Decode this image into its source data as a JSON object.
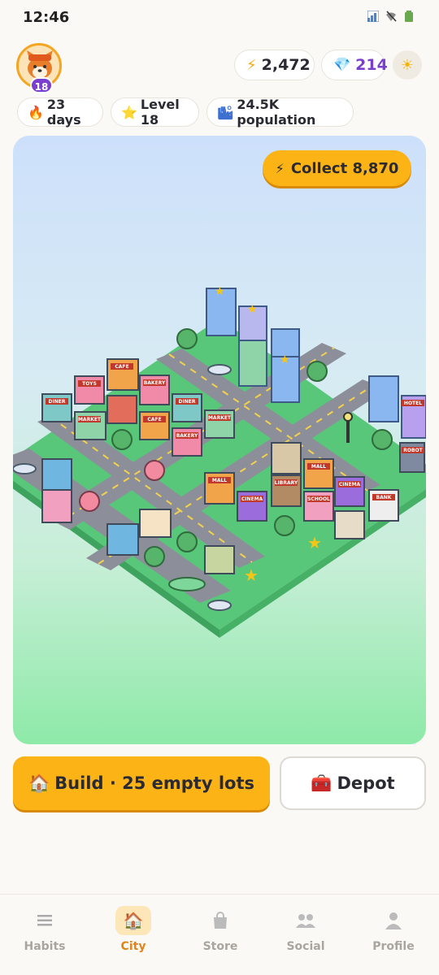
{
  "status_bar": {
    "time": "12:46"
  },
  "header": {
    "avatar_level": "18",
    "energy": "2,472",
    "gems": "214"
  },
  "stats": {
    "streak": "23 days",
    "level": "Level 18",
    "population": "24.5K population"
  },
  "city": {
    "collect_label": "Collect 8,870",
    "building_signs": [
      "DINER",
      "TOYS",
      "CAFE",
      "BAKERY",
      "MARKET",
      "DINER",
      "MARKET",
      "CAFE",
      "BAKERY",
      "MALL",
      "LIBRARY",
      "CINEMA",
      "SCHOOL",
      "MALL",
      "CINEMA",
      "BANK",
      "HOTEL",
      "ROBOT"
    ]
  },
  "actions": {
    "build_label": "Build · 25 empty lots",
    "depot_label": "Depot"
  },
  "nav": {
    "habits": "Habits",
    "city": "City",
    "store": "Store",
    "social": "Social",
    "profile": "Profile"
  },
  "colors": {
    "accent": "#fbb316",
    "gem": "#7b3fd0",
    "active_nav": "#e0841a"
  }
}
